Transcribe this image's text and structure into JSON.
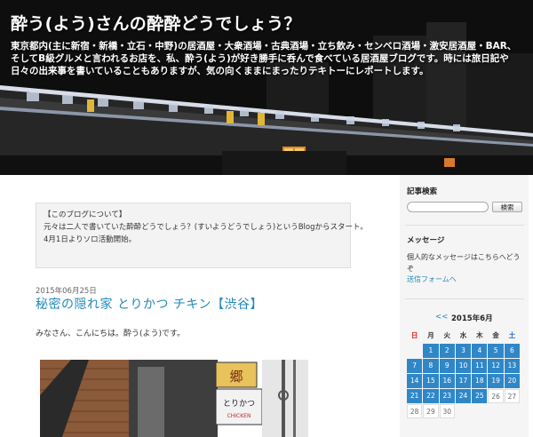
{
  "header": {
    "title": "酔う(よう)さんの酔酔どうでしょう？",
    "description": "東京都内(主に新宿・新橋・立石・中野)の居酒屋・大衆酒場・古典酒場・立ち飲み・センベロ酒場・激安居酒屋・BAR、そしてB級グルメと言われるお店を、私、酔う(よう)が好き勝手に呑んで食べている居酒屋ブログです。時には旅日記や日々の出来事を書いていることもありますが、気の向くままにまったりテキトーにレポートします。"
  },
  "about": {
    "lines": [
      "【このブログについて】",
      "元々は二人で書いていた酔酔どうでしょう？(すいようどうでしょう)というBlogからスタート。",
      "4月1日よりソロ活動開始。"
    ]
  },
  "post": {
    "date": "2015年06月25日",
    "title": "秘密の隠れ家 とりかつ チキン【渋谷】",
    "greeting": "みなさん、こんにちは。酔う(よう)です。",
    "image_signs": {
      "sign1": "郷",
      "sign2": "とりかつ",
      "sign2_sub": "CHICKEN"
    }
  },
  "sidebar": {
    "search": {
      "title": "記事検索",
      "placeholder": "",
      "button": "検索"
    },
    "message": {
      "title": "メッセージ",
      "text": "個人的なメッセージはこちらへどうぞ",
      "link": "送信フォームへ"
    },
    "calendar": {
      "prev": "<<",
      "month_label": "2015年6月",
      "weekdays": [
        "日",
        "月",
        "火",
        "水",
        "木",
        "金",
        "土"
      ],
      "rows": [
        [
          {
            "d": "",
            "t": "empty"
          },
          {
            "d": "1",
            "t": "link"
          },
          {
            "d": "2",
            "t": "link"
          },
          {
            "d": "3",
            "t": "link"
          },
          {
            "d": "4",
            "t": "link"
          },
          {
            "d": "5",
            "t": "link"
          },
          {
            "d": "6",
            "t": "link"
          }
        ],
        [
          {
            "d": "7",
            "t": "link"
          },
          {
            "d": "8",
            "t": "link"
          },
          {
            "d": "9",
            "t": "link"
          },
          {
            "d": "10",
            "t": "link"
          },
          {
            "d": "11",
            "t": "link"
          },
          {
            "d": "12",
            "t": "link"
          },
          {
            "d": "13",
            "t": "link"
          }
        ],
        [
          {
            "d": "14",
            "t": "link"
          },
          {
            "d": "15",
            "t": "link"
          },
          {
            "d": "16",
            "t": "link"
          },
          {
            "d": "17",
            "t": "link"
          },
          {
            "d": "18",
            "t": "link"
          },
          {
            "d": "19",
            "t": "link"
          },
          {
            "d": "20",
            "t": "link"
          }
        ],
        [
          {
            "d": "21",
            "t": "link"
          },
          {
            "d": "22",
            "t": "link"
          },
          {
            "d": "23",
            "t": "link"
          },
          {
            "d": "24",
            "t": "link"
          },
          {
            "d": "25",
            "t": "link"
          },
          {
            "d": "26",
            "t": "plain"
          },
          {
            "d": "27",
            "t": "plain"
          }
        ],
        [
          {
            "d": "28",
            "t": "plain"
          },
          {
            "d": "29",
            "t": "plain"
          },
          {
            "d": "30",
            "t": "plain"
          },
          {
            "d": "",
            "t": "empty"
          },
          {
            "d": "",
            "t": "empty"
          },
          {
            "d": "",
            "t": "empty"
          },
          {
            "d": "",
            "t": "empty"
          }
        ]
      ]
    }
  },
  "colors": {
    "link": "#2288bb",
    "calendar_active": "#2f87c8",
    "sunday": "#dd2222",
    "saturday": "#2266cc"
  }
}
